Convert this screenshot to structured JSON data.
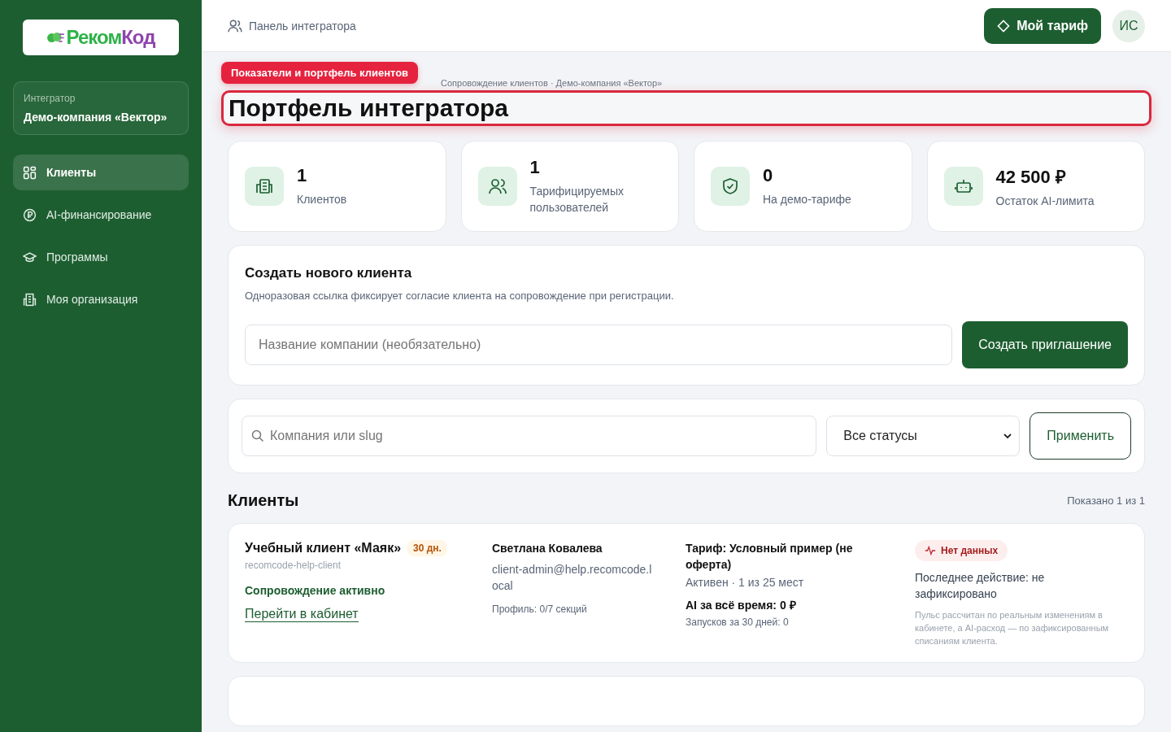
{
  "sidebar": {
    "logo": [
      "Реком",
      "Код"
    ],
    "org_label": "Интегратор",
    "org_name": "Демо-компания «Вектор»",
    "items": [
      {
        "label": "Клиенты",
        "selected": true
      },
      {
        "label": "AI-финансирование",
        "selected": false
      },
      {
        "label": "Программы",
        "selected": false
      },
      {
        "label": "Моя организация",
        "selected": false
      }
    ]
  },
  "topbar": {
    "title": "Панель интегратора",
    "plan_button": "Мой тариф",
    "avatar": "ИС"
  },
  "guide": {
    "badge": "Показатели и портфель клиентов"
  },
  "breadcrumb": "Сопровождение клиентов · Демо-компания «Вектор»",
  "heading": "Портфель интегратора",
  "stats": [
    {
      "value": "1",
      "label": "Клиентов"
    },
    {
      "value": "1",
      "label": "Тарифицируемых пользователей"
    },
    {
      "value": "0",
      "label": "На демо-тарифе"
    },
    {
      "value": "42 500 ₽",
      "label": "Остаток AI-лимита"
    }
  ],
  "create": {
    "title": "Создать нового клиента",
    "description": "Одноразовая ссылка фиксирует согласие клиента на сопровождение при регистрации.",
    "placeholder": "Название компании (необязательно)",
    "button": "Создать приглашение"
  },
  "filter": {
    "placeholder": "Компания или slug",
    "status": "Все статусы",
    "button": "Применить"
  },
  "clients": {
    "title": "Клиенты",
    "count": "Показано 1 из 1",
    "rows": [
      {
        "name": "Учебный клиент «Маяк»",
        "days": "30 дн.",
        "slug": "recomcode-help-client",
        "status": "Сопровождение активно",
        "link": "Перейти в кабинет",
        "contact": "Светлана Ковалева",
        "email": "client-admin@help.recomcode.local",
        "profile": "Профиль: 0/7 секций",
        "plan": "Тариф: Условный пример (не оферта)",
        "plan_state": "Активен · 1 из 25 мест",
        "ai": "AI за всё время: 0 ₽",
        "runs": "Запусков за 30 дней: 0",
        "pulse": "Нет данных",
        "last": "Последнее действие: не зафиксировано",
        "note": "Пульс рассчитан по реальным изменениям в кабинете, а AI-расход — по зафиксированным списаниям клиента."
      }
    ]
  }
}
